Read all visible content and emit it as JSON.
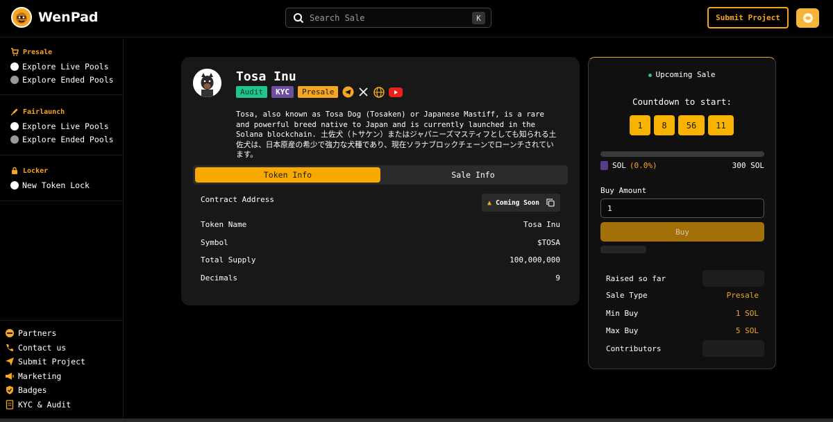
{
  "header": {
    "app_name": "WenPad",
    "search_placeholder": "Search Sale",
    "search_shortcut": "K",
    "submit_label": "Submit Project"
  },
  "sidebar": {
    "presale": {
      "heading": "Presale",
      "items": [
        {
          "label": "Explore Live Pools"
        },
        {
          "label": "Explore Ended Pools"
        }
      ]
    },
    "fairlaunch": {
      "heading": "Fairlaunch",
      "items": [
        {
          "label": "Explore Live Pools"
        },
        {
          "label": "Explore Ended Pools"
        }
      ]
    },
    "locker": {
      "heading": "Locker",
      "items": [
        {
          "label": "New Token Lock"
        }
      ]
    },
    "footer": [
      {
        "label": "Partners",
        "icon": "handshake-icon"
      },
      {
        "label": "Contact us",
        "icon": "phone-icon"
      },
      {
        "label": "Submit Project",
        "icon": "send-icon"
      },
      {
        "label": "Marketing",
        "icon": "megaphone-icon"
      },
      {
        "label": "Badges",
        "icon": "shield-check-icon"
      },
      {
        "label": "KYC & Audit",
        "icon": "document-icon"
      }
    ]
  },
  "token": {
    "name": "Tosa Inu",
    "badges": {
      "audit": "Audit",
      "kyc": "KYC",
      "presale": "Presale"
    },
    "description": "Tosa, also known as Tosa Dog (Tosaken) or Japanese Mastiff, is a rare and powerful breed native to Japan and is currently launched in the Solana blockchain. 土佐犬（トサケン）またはジャパニーズマスティフとしても知られる土佐犬は、日本原産の希少で強力な犬種であり、現在ソラナブロックチェーンでローンチされています。",
    "tabs": [
      {
        "label": "Token Info",
        "active": true
      },
      {
        "label": "Sale Info",
        "active": false
      }
    ],
    "contract_label": "Contract Address",
    "contract_status": "Coming Soon",
    "info": [
      {
        "label": "Token Name",
        "value": "Tosa Inu"
      },
      {
        "label": "Symbol",
        "value": "$TOSA"
      },
      {
        "label": "Total Supply",
        "value": "100,000,000"
      },
      {
        "label": "Decimals",
        "value": "9"
      }
    ]
  },
  "sale": {
    "status": "Upcoming Sale",
    "countdown_label": "Countdown to start:",
    "countdown": [
      "1",
      "8",
      "56",
      "11"
    ],
    "progress_fraction": 0.0,
    "currency": "SOL",
    "progress_pct": "(0.0%)",
    "progress_max": "300 SOL",
    "buy_amount_label": "Buy Amount",
    "buy_amount_value": "1",
    "buy_label": "Buy",
    "stats": [
      {
        "label": "Raised so far",
        "value": ""
      },
      {
        "label": "Sale Type",
        "value": "Presale"
      },
      {
        "label": "Min Buy",
        "value": "1 SOL"
      },
      {
        "label": "Max Buy",
        "value": "5 SOL"
      },
      {
        "label": "Contributors",
        "value": ""
      }
    ]
  },
  "colors": {
    "accent": "#f5a623",
    "audit_badge": "#1fc48f",
    "kyc_badge": "#6b4ea0"
  }
}
